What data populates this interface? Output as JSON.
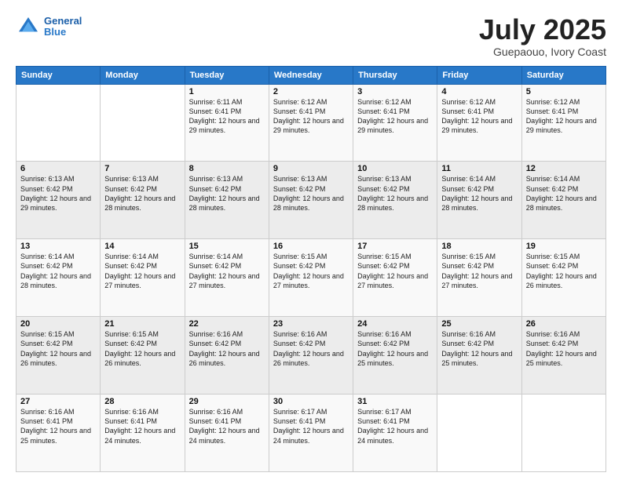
{
  "header": {
    "logo_line1": "General",
    "logo_line2": "Blue",
    "title": "July 2025",
    "subtitle": "Guepaouo, Ivory Coast"
  },
  "calendar": {
    "days_of_week": [
      "Sunday",
      "Monday",
      "Tuesday",
      "Wednesday",
      "Thursday",
      "Friday",
      "Saturday"
    ],
    "weeks": [
      [
        {
          "day": "",
          "info": ""
        },
        {
          "day": "",
          "info": ""
        },
        {
          "day": "1",
          "info": "Sunrise: 6:11 AM\nSunset: 6:41 PM\nDaylight: 12 hours and 29 minutes."
        },
        {
          "day": "2",
          "info": "Sunrise: 6:12 AM\nSunset: 6:41 PM\nDaylight: 12 hours and 29 minutes."
        },
        {
          "day": "3",
          "info": "Sunrise: 6:12 AM\nSunset: 6:41 PM\nDaylight: 12 hours and 29 minutes."
        },
        {
          "day": "4",
          "info": "Sunrise: 6:12 AM\nSunset: 6:41 PM\nDaylight: 12 hours and 29 minutes."
        },
        {
          "day": "5",
          "info": "Sunrise: 6:12 AM\nSunset: 6:41 PM\nDaylight: 12 hours and 29 minutes."
        }
      ],
      [
        {
          "day": "6",
          "info": "Sunrise: 6:13 AM\nSunset: 6:42 PM\nDaylight: 12 hours and 29 minutes."
        },
        {
          "day": "7",
          "info": "Sunrise: 6:13 AM\nSunset: 6:42 PM\nDaylight: 12 hours and 28 minutes."
        },
        {
          "day": "8",
          "info": "Sunrise: 6:13 AM\nSunset: 6:42 PM\nDaylight: 12 hours and 28 minutes."
        },
        {
          "day": "9",
          "info": "Sunrise: 6:13 AM\nSunset: 6:42 PM\nDaylight: 12 hours and 28 minutes."
        },
        {
          "day": "10",
          "info": "Sunrise: 6:13 AM\nSunset: 6:42 PM\nDaylight: 12 hours and 28 minutes."
        },
        {
          "day": "11",
          "info": "Sunrise: 6:14 AM\nSunset: 6:42 PM\nDaylight: 12 hours and 28 minutes."
        },
        {
          "day": "12",
          "info": "Sunrise: 6:14 AM\nSunset: 6:42 PM\nDaylight: 12 hours and 28 minutes."
        }
      ],
      [
        {
          "day": "13",
          "info": "Sunrise: 6:14 AM\nSunset: 6:42 PM\nDaylight: 12 hours and 28 minutes."
        },
        {
          "day": "14",
          "info": "Sunrise: 6:14 AM\nSunset: 6:42 PM\nDaylight: 12 hours and 27 minutes."
        },
        {
          "day": "15",
          "info": "Sunrise: 6:14 AM\nSunset: 6:42 PM\nDaylight: 12 hours and 27 minutes."
        },
        {
          "day": "16",
          "info": "Sunrise: 6:15 AM\nSunset: 6:42 PM\nDaylight: 12 hours and 27 minutes."
        },
        {
          "day": "17",
          "info": "Sunrise: 6:15 AM\nSunset: 6:42 PM\nDaylight: 12 hours and 27 minutes."
        },
        {
          "day": "18",
          "info": "Sunrise: 6:15 AM\nSunset: 6:42 PM\nDaylight: 12 hours and 27 minutes."
        },
        {
          "day": "19",
          "info": "Sunrise: 6:15 AM\nSunset: 6:42 PM\nDaylight: 12 hours and 26 minutes."
        }
      ],
      [
        {
          "day": "20",
          "info": "Sunrise: 6:15 AM\nSunset: 6:42 PM\nDaylight: 12 hours and 26 minutes."
        },
        {
          "day": "21",
          "info": "Sunrise: 6:15 AM\nSunset: 6:42 PM\nDaylight: 12 hours and 26 minutes."
        },
        {
          "day": "22",
          "info": "Sunrise: 6:16 AM\nSunset: 6:42 PM\nDaylight: 12 hours and 26 minutes."
        },
        {
          "day": "23",
          "info": "Sunrise: 6:16 AM\nSunset: 6:42 PM\nDaylight: 12 hours and 26 minutes."
        },
        {
          "day": "24",
          "info": "Sunrise: 6:16 AM\nSunset: 6:42 PM\nDaylight: 12 hours and 25 minutes."
        },
        {
          "day": "25",
          "info": "Sunrise: 6:16 AM\nSunset: 6:42 PM\nDaylight: 12 hours and 25 minutes."
        },
        {
          "day": "26",
          "info": "Sunrise: 6:16 AM\nSunset: 6:42 PM\nDaylight: 12 hours and 25 minutes."
        }
      ],
      [
        {
          "day": "27",
          "info": "Sunrise: 6:16 AM\nSunset: 6:41 PM\nDaylight: 12 hours and 25 minutes."
        },
        {
          "day": "28",
          "info": "Sunrise: 6:16 AM\nSunset: 6:41 PM\nDaylight: 12 hours and 24 minutes."
        },
        {
          "day": "29",
          "info": "Sunrise: 6:16 AM\nSunset: 6:41 PM\nDaylight: 12 hours and 24 minutes."
        },
        {
          "day": "30",
          "info": "Sunrise: 6:17 AM\nSunset: 6:41 PM\nDaylight: 12 hours and 24 minutes."
        },
        {
          "day": "31",
          "info": "Sunrise: 6:17 AM\nSunset: 6:41 PM\nDaylight: 12 hours and 24 minutes."
        },
        {
          "day": "",
          "info": ""
        },
        {
          "day": "",
          "info": ""
        }
      ]
    ]
  }
}
